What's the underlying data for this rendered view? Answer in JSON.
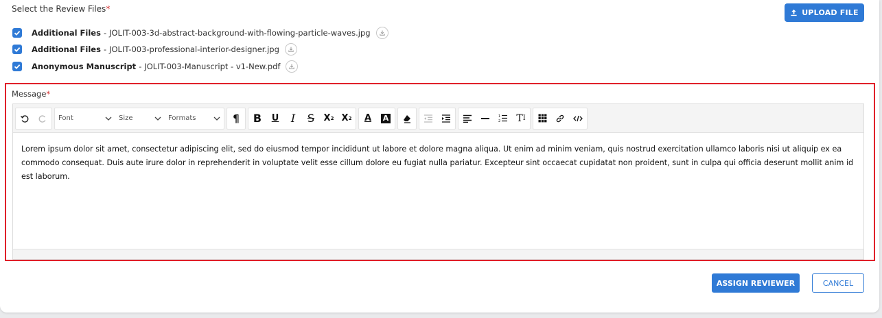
{
  "review_files": {
    "title": "Select the Review Files",
    "required_mark": "*",
    "upload_label": "UPLOAD FILE",
    "files": [
      {
        "label": "Additional Files",
        "separator": "-",
        "name": "JOLIT-003-3d-abstract-background-with-flowing-particle-waves.jpg",
        "checked": true
      },
      {
        "label": "Additional Files",
        "separator": "-",
        "name": "JOLIT-003-professional-interior-designer.jpg",
        "checked": true
      },
      {
        "label": "Anonymous Manuscript",
        "separator": "-",
        "name": "JOLIT-003-Manuscript - v1-New.pdf",
        "checked": true
      }
    ]
  },
  "message": {
    "label": "Message",
    "required_mark": "*",
    "toolbar": {
      "font": "Font",
      "size": "Size",
      "formats": "Formats",
      "tools": [
        "undo-icon",
        "redo-icon",
        "paragraph-icon",
        "bold-icon",
        "underline-icon",
        "italic-icon",
        "strikethrough-icon",
        "subscript-icon",
        "superscript-icon",
        "font-color-icon",
        "highlight-color-icon",
        "eraser-icon",
        "outdent-icon",
        "indent-icon",
        "align-icon",
        "horizontal-rule-icon",
        "ordered-list-icon",
        "text-style-icon",
        "table-icon",
        "link-icon",
        "code-view-icon"
      ]
    },
    "body": "Lorem ipsum dolor sit amet, consectetur adipiscing elit, sed do eiusmod tempor incididunt ut labore et dolore magna aliqua. Ut enim ad minim veniam, quis nostrud exercitation ullamco laboris nisi ut aliquip ex ea commodo consequat. Duis aute irure dolor in reprehenderit in voluptate velit esse cillum dolore eu fugiat nulla pariatur. Excepteur sint occaecat cupidatat non proident, sunt in culpa qui officia deserunt mollit anim id est laborum."
  },
  "actions": {
    "assign": "ASSIGN REVIEWER",
    "cancel": "CANCEL"
  },
  "colors": {
    "primary": "#2f7ad6",
    "highlight_border": "#e0202a",
    "required": "#d32f2f"
  }
}
